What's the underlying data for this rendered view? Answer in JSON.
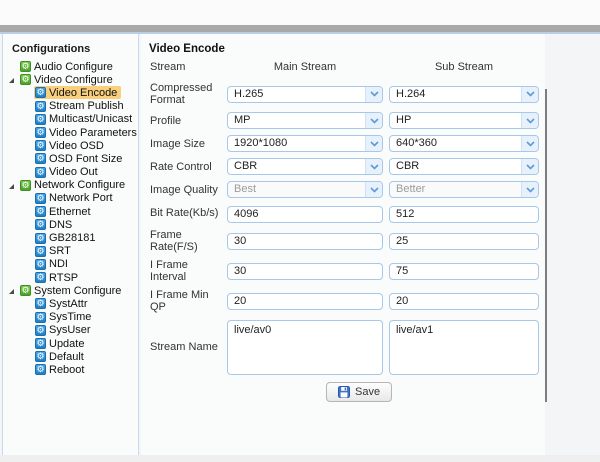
{
  "sidebar": {
    "title": "Configurations",
    "items": [
      {
        "label": "Audio Configure",
        "type": "parent",
        "icon": "gears-icon",
        "expanded": false,
        "selected": false
      },
      {
        "label": "Video Configure",
        "type": "parent",
        "icon": "gears-icon",
        "expanded": true,
        "selected": false
      },
      {
        "label": "Video Encode",
        "type": "leaf",
        "icon": "gear-icon",
        "selected": true
      },
      {
        "label": "Stream Publish",
        "type": "leaf",
        "icon": "gear-icon",
        "selected": false
      },
      {
        "label": "Multicast/Unicast",
        "type": "leaf",
        "icon": "gear-icon",
        "selected": false
      },
      {
        "label": "Video Parameters",
        "type": "leaf",
        "icon": "gear-icon",
        "selected": false
      },
      {
        "label": "Video OSD",
        "type": "leaf",
        "icon": "gear-icon",
        "selected": false
      },
      {
        "label": "OSD Font Size",
        "type": "leaf",
        "icon": "gear-icon",
        "selected": false
      },
      {
        "label": "Video Out",
        "type": "leaf",
        "icon": "gear-icon",
        "selected": false
      },
      {
        "label": "Network Configure",
        "type": "parent",
        "icon": "gears-icon",
        "expanded": true,
        "selected": false
      },
      {
        "label": "Network Port",
        "type": "leaf",
        "icon": "gear-icon",
        "selected": false
      },
      {
        "label": "Ethernet",
        "type": "leaf",
        "icon": "gear-icon",
        "selected": false
      },
      {
        "label": "DNS",
        "type": "leaf",
        "icon": "gear-icon",
        "selected": false
      },
      {
        "label": "GB28181",
        "type": "leaf",
        "icon": "gear-icon",
        "selected": false
      },
      {
        "label": "SRT",
        "type": "leaf",
        "icon": "gear-icon",
        "selected": false
      },
      {
        "label": "NDI",
        "type": "leaf",
        "icon": "gear-icon",
        "selected": false
      },
      {
        "label": "RTSP",
        "type": "leaf",
        "icon": "gear-icon",
        "selected": false
      },
      {
        "label": "System Configure",
        "type": "parent",
        "icon": "gears-icon",
        "expanded": true,
        "selected": false
      },
      {
        "label": "SystAttr",
        "type": "leaf",
        "icon": "gear-icon",
        "selected": false
      },
      {
        "label": "SysTime",
        "type": "leaf",
        "icon": "gear-icon",
        "selected": false
      },
      {
        "label": "SysUser",
        "type": "leaf",
        "icon": "gear-icon",
        "selected": false
      },
      {
        "label": "Update",
        "type": "leaf",
        "icon": "gear-icon",
        "selected": false
      },
      {
        "label": "Default",
        "type": "leaf",
        "icon": "gear-icon",
        "selected": false
      },
      {
        "label": "Reboot",
        "type": "leaf",
        "icon": "gear-icon",
        "selected": false
      }
    ]
  },
  "main": {
    "title": "Video Encode",
    "header": {
      "row_label": "Stream",
      "main_col": "Main Stream",
      "sub_col": "Sub Stream"
    },
    "rows": [
      {
        "label": "Compressed Format",
        "control": "select",
        "disabled": false,
        "main": "H.265",
        "sub": "H.264"
      },
      {
        "label": "Profile",
        "control": "select",
        "disabled": false,
        "main": "MP",
        "sub": "HP"
      },
      {
        "label": "Image Size",
        "control": "select",
        "disabled": false,
        "main": "1920*1080",
        "sub": "640*360"
      },
      {
        "label": "Rate Control",
        "control": "select",
        "disabled": false,
        "main": "CBR",
        "sub": "CBR"
      },
      {
        "label": "Image Quality",
        "control": "select",
        "disabled": true,
        "main": "Best",
        "sub": "Better"
      },
      {
        "label": "Bit Rate(Kb/s)",
        "control": "input",
        "disabled": false,
        "main": "4096",
        "sub": "512"
      },
      {
        "label": "Frame Rate(F/S)",
        "control": "input",
        "disabled": false,
        "main": "30",
        "sub": "25"
      },
      {
        "label": "I Frame Interval",
        "control": "input",
        "disabled": false,
        "main": "30",
        "sub": "75"
      },
      {
        "label": "I Frame Min QP",
        "control": "input",
        "disabled": false,
        "main": "20",
        "sub": "20"
      }
    ],
    "stream_name": {
      "label": "Stream Name",
      "main": "live/av0",
      "sub": "live/av1"
    },
    "save": {
      "label": "Save",
      "icon": "save-floppy-icon"
    }
  },
  "colors": {
    "selected_highlight": "#f8cf7c",
    "parent_icon_green": "#5cb335",
    "leaf_icon_blue": "#2f8fd0",
    "field_border": "#a9c7e9",
    "chevron_blue": "#5b9bd5",
    "top_bar_gray": "#a9a9a9",
    "panel_border_blue": "#b9cde6"
  }
}
